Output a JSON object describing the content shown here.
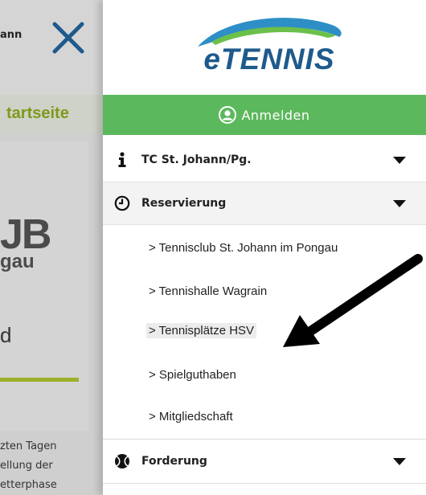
{
  "background_page": {
    "truncated_title": "ann",
    "startseite_label": "tartseite",
    "logo_fragment": "JB",
    "logo_sub_fragment": "gau",
    "letter_fragment": "d",
    "paragraph_lines": [
      "zten Tagen",
      "ellung der",
      "etterphase"
    ],
    "accent_color": "#9eb029"
  },
  "drawer": {
    "logo_text": "eTENNIS",
    "login_label": "Anmelden",
    "login_color": "#5cb85c",
    "menu": [
      {
        "label": "TC St. Johann/Pg.",
        "icon": "info-icon",
        "expanded": false
      },
      {
        "label": "Reservierung",
        "icon": "clock-icon",
        "expanded": true
      },
      {
        "label": "Forderung",
        "icon": "tennis-ball-icon",
        "expanded": false
      }
    ],
    "reservierung_items": [
      "> Tennisclub St. Johann im Pongau",
      "> Tennishalle Wagrain",
      "> Tennisplätze HSV",
      "> Spielguthaben",
      "> Mitgliedschaft"
    ],
    "highlighted_item": "> Tennisplätze HSV"
  }
}
